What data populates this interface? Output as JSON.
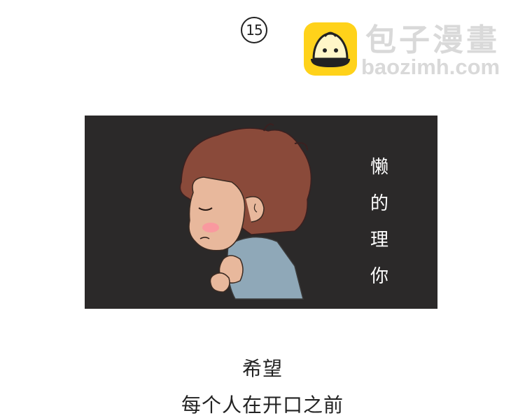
{
  "page_number": "15",
  "watermark": {
    "logo_icon": "steamed-bun-icon",
    "title": "包子漫畫",
    "url": "baozimh.com"
  },
  "panel": {
    "title_chars": [
      "懒",
      "的",
      "理",
      "你"
    ],
    "background_color": "#2b2929",
    "illustration": "sulking-boy-illustration"
  },
  "captions": [
    "希望",
    "每个人在开口之前"
  ]
}
